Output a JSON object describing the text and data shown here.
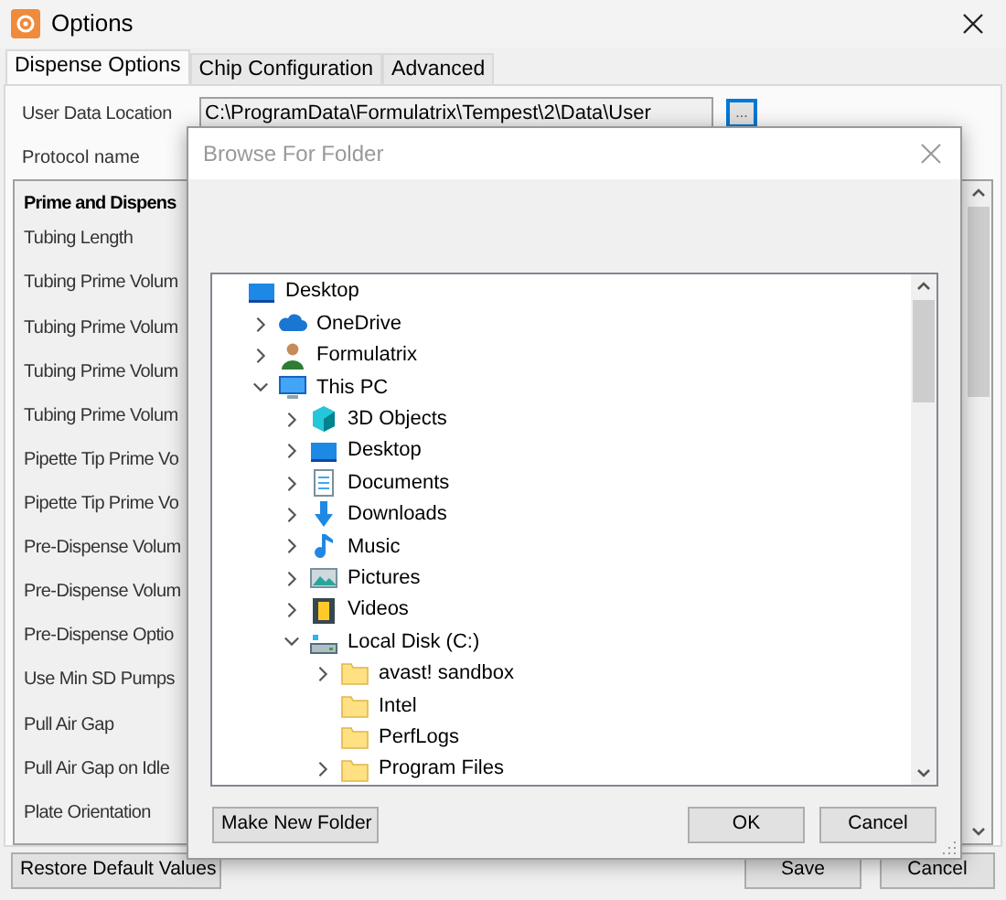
{
  "window": {
    "title": "Options"
  },
  "tabs": [
    {
      "label": "Dispense Options",
      "selected": true
    },
    {
      "label": "Chip Configuration",
      "selected": false
    },
    {
      "label": "Advanced",
      "selected": false
    }
  ],
  "user_data_location": {
    "label": "User Data Location",
    "value": "C:\\ProgramData\\Formulatrix\\Tempest\\2\\Data\\User",
    "browse_button": "..."
  },
  "protocol_name": {
    "label": "Protocol name"
  },
  "settings": {
    "heading": "Prime and Dispens",
    "rows": [
      "Tubing Length",
      "Tubing Prime Volum",
      "Tubing Prime Volum",
      "Tubing Prime Volum",
      "Tubing Prime Volum",
      "Pipette Tip Prime Vo",
      "Pipette Tip Prime Vo",
      "Pre-Dispense Volum",
      "Pre-Dispense Volum",
      "Pre-Dispense Optio",
      "Use Min SD Pumps",
      "Pull Air Gap",
      "Pull Air Gap on Idle",
      "Plate Orientation"
    ]
  },
  "buttons": [
    "Restore Default Values",
    "Save",
    "Cancel"
  ],
  "dialog": {
    "title": "Browse For Folder",
    "tree": [
      {
        "label": "Desktop",
        "kind": "desktop",
        "children": [
          {
            "label": "OneDrive",
            "kind": "cloud",
            "expanded": false
          },
          {
            "label": "Formulatrix",
            "kind": "user",
            "expanded": false
          },
          {
            "label": "This PC",
            "kind": "pc",
            "expanded": true,
            "children": [
              {
                "label": "3D Objects",
                "kind": "cube",
                "expanded": false
              },
              {
                "label": "Desktop",
                "kind": "desktop",
                "expanded": false
              },
              {
                "label": "Documents",
                "kind": "documents",
                "expanded": false
              },
              {
                "label": "Downloads",
                "kind": "downloads",
                "expanded": false
              },
              {
                "label": "Music",
                "kind": "music",
                "expanded": false
              },
              {
                "label": "Pictures",
                "kind": "pictures",
                "expanded": false
              },
              {
                "label": "Videos",
                "kind": "videos",
                "expanded": false
              },
              {
                "label": "Local Disk (C:)",
                "kind": "drive",
                "expanded": true,
                "children": [
                  {
                    "label": "avast! sandbox",
                    "kind": "folder",
                    "expanded": false
                  },
                  {
                    "label": "Intel",
                    "kind": "folder"
                  },
                  {
                    "label": "PerfLogs",
                    "kind": "folder"
                  },
                  {
                    "label": "Program Files",
                    "kind": "folder",
                    "expanded": false
                  }
                ]
              }
            ]
          }
        ]
      }
    ],
    "buttons": [
      "Make New Folder",
      "OK",
      "Cancel"
    ]
  }
}
